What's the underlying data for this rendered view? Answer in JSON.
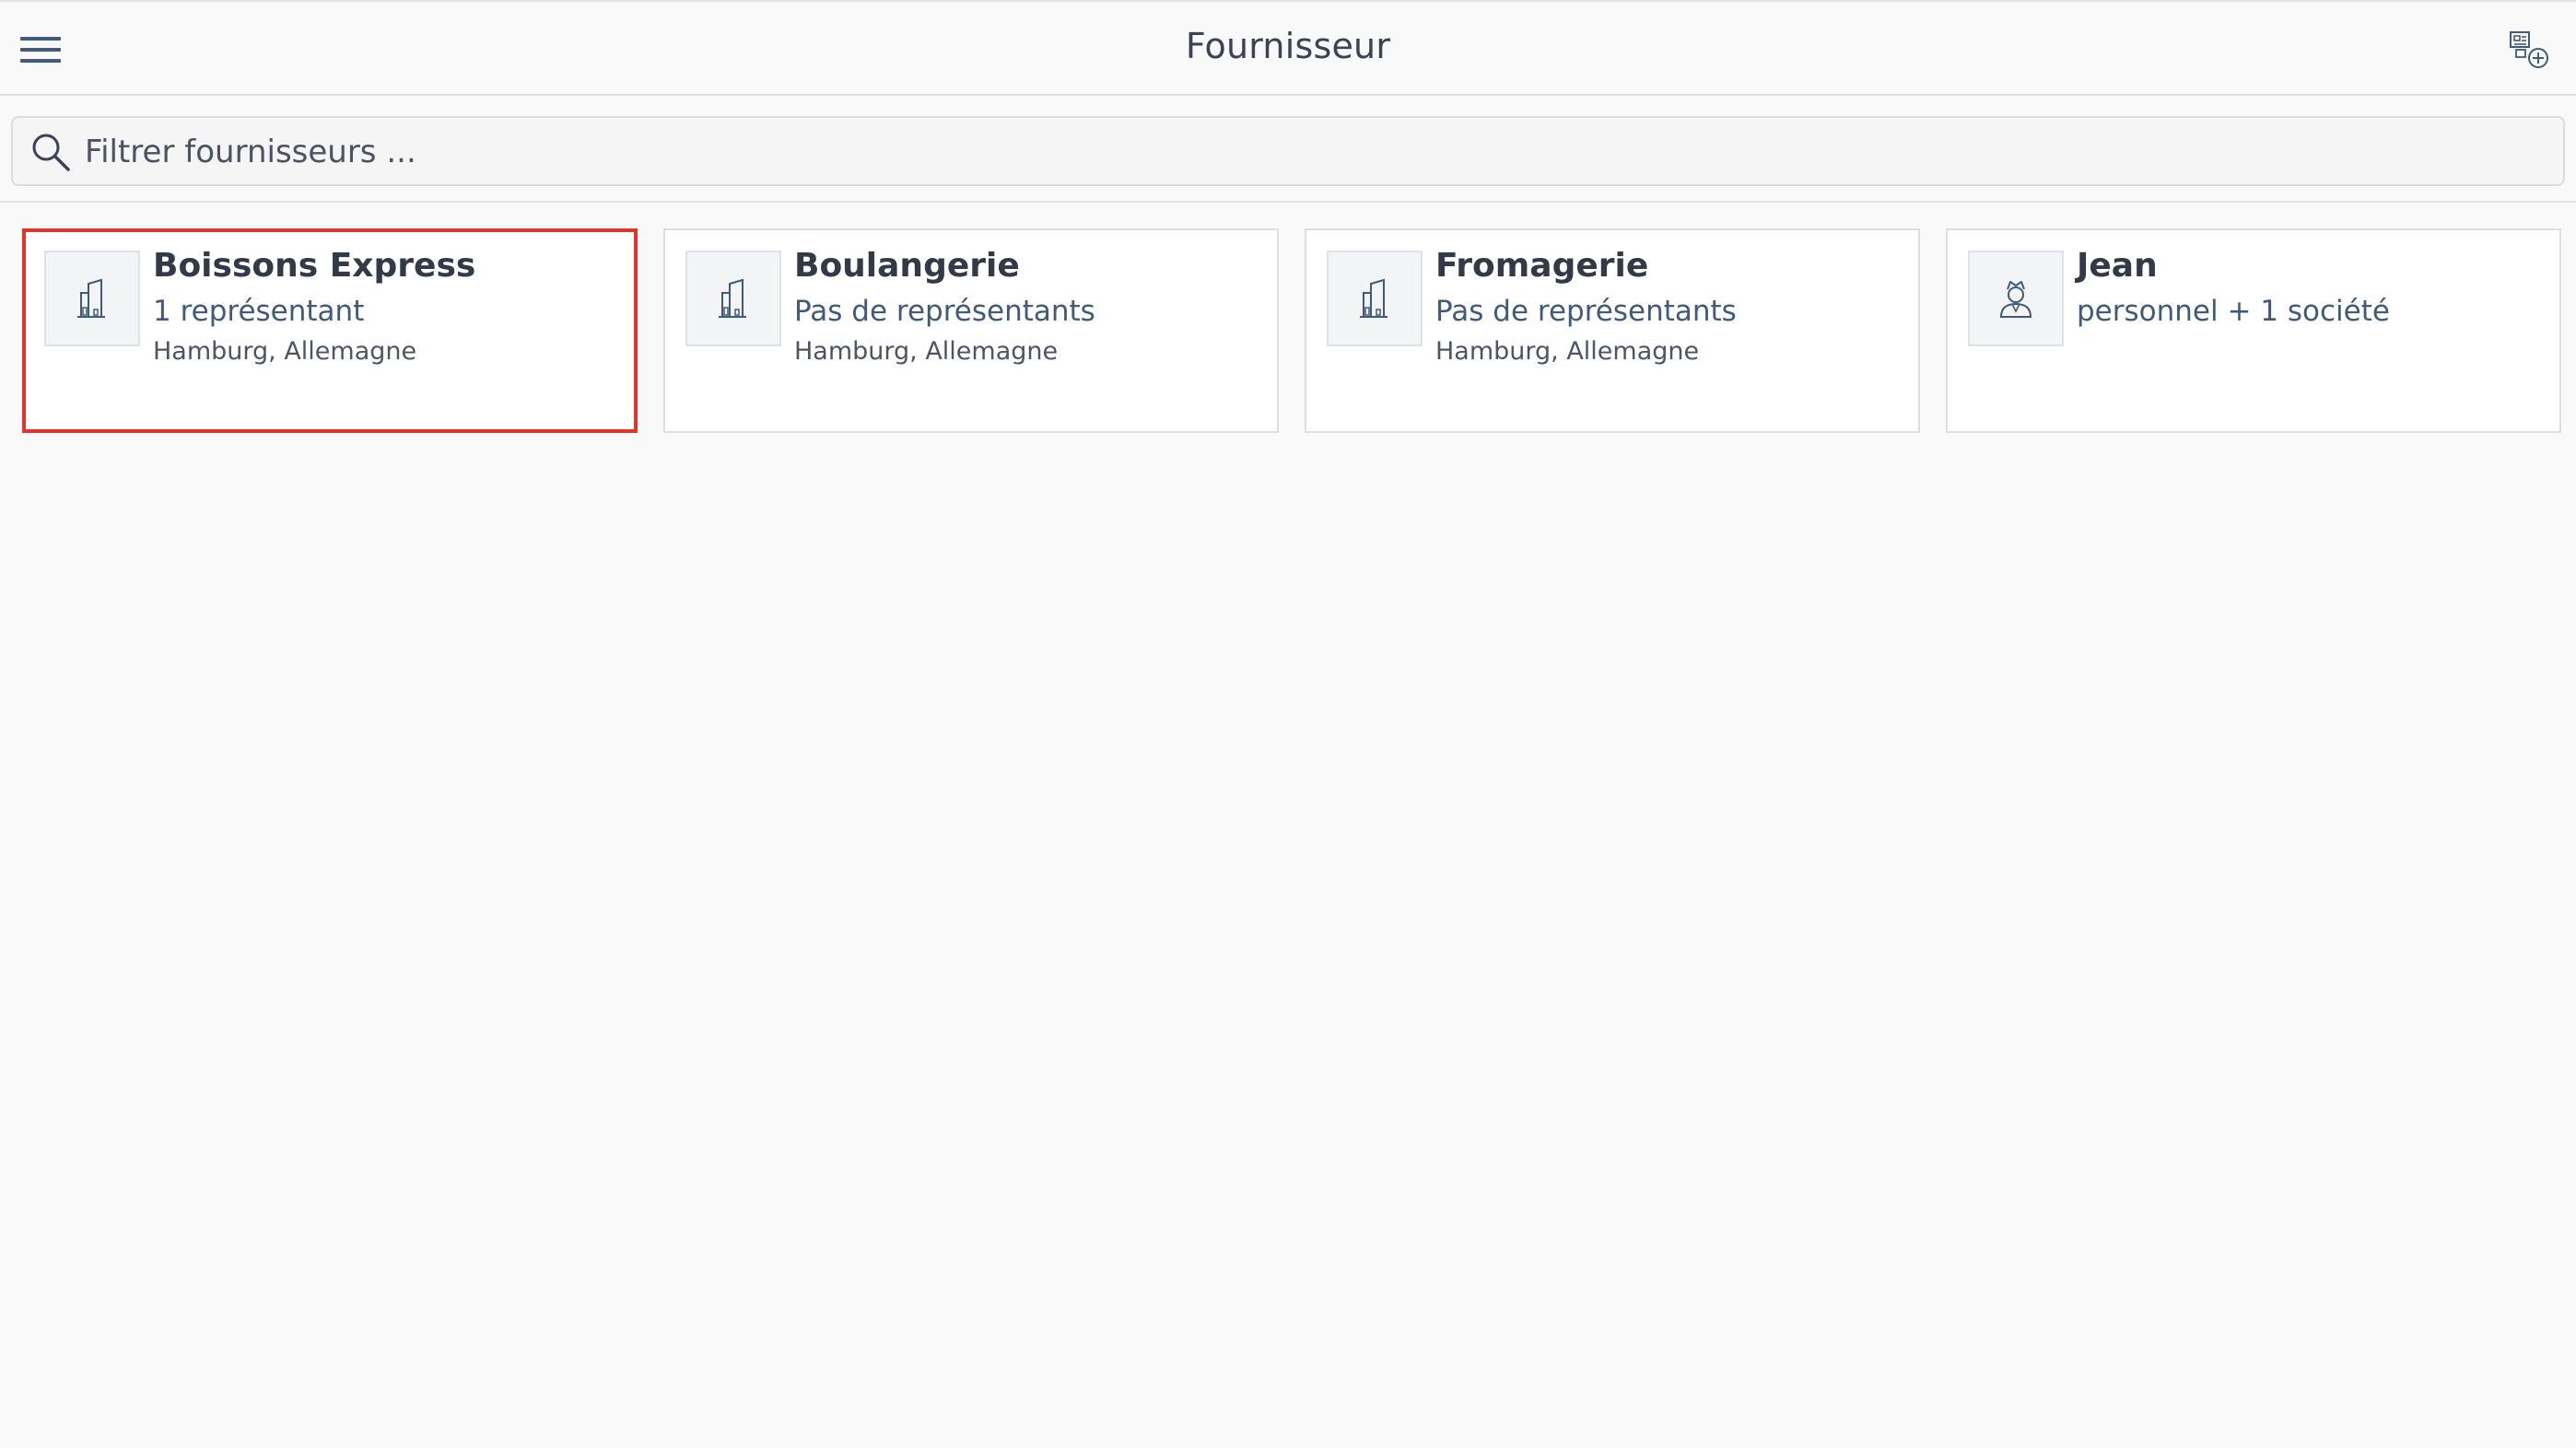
{
  "header": {
    "title": "Fournisseur",
    "menu_icon": "hamburger-menu-icon",
    "add_icon": "add-supplier-icon"
  },
  "search": {
    "placeholder": "Filtrer fournisseurs ..."
  },
  "colors": {
    "accent": "#3f5a7a",
    "selected_border": "#e0352b",
    "background": "#f9f9f9"
  },
  "suppliers": [
    {
      "name": "Boissons Express",
      "subtitle": "1 représentant",
      "location": "Hamburg, Allemagne",
      "icon": "building-icon",
      "selected": true
    },
    {
      "name": "Boulangerie",
      "subtitle": "Pas de représentants",
      "location": "Hamburg, Allemagne",
      "icon": "building-icon",
      "selected": false
    },
    {
      "name": "Fromagerie",
      "subtitle": "Pas de représentants",
      "location": "Hamburg, Allemagne",
      "icon": "building-icon",
      "selected": false
    },
    {
      "name": "Jean",
      "subtitle": "personnel + 1 société",
      "location": "",
      "icon": "person-icon",
      "selected": false
    }
  ]
}
